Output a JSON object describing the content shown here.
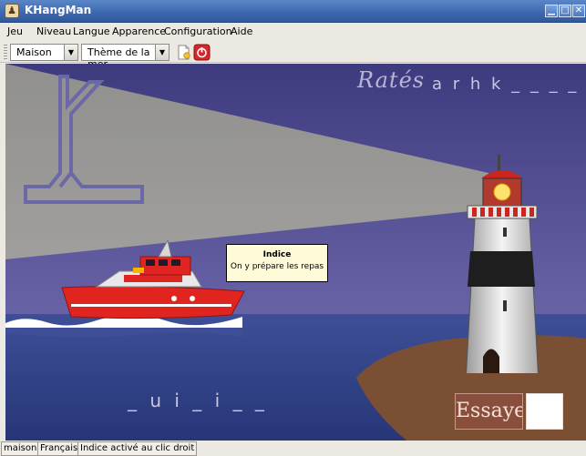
{
  "window": {
    "title": "KHangMan"
  },
  "menubar": {
    "items": [
      {
        "label": "Jeu"
      },
      {
        "label": "Niveau"
      },
      {
        "label": "Langue"
      },
      {
        "label": "Apparence"
      },
      {
        "label": "Configuration"
      },
      {
        "label": "Aide"
      }
    ]
  },
  "toolbar": {
    "category": "Maison",
    "theme": "Thème de la mer",
    "new_game_icon": "new-document-icon",
    "quit_icon": "power-icon"
  },
  "game": {
    "missed_label": "Ratés",
    "missed_letters": "a r h k _ _ _ _ _",
    "word_display": "_ u i _ i _ _",
    "try_button": "Essayer",
    "letter_input_value": ""
  },
  "hint": {
    "title": "Indice",
    "text": "On y prépare les repas"
  },
  "statusbar": {
    "category": "maison",
    "language": "Français",
    "hint_mode": "Indice activé au clic droit"
  },
  "colors": {
    "sky_top": "#3e3a7e",
    "sky_bottom": "#5f5a9e",
    "sea": "#2d3f86",
    "rock": "#7a4f33",
    "boat_red": "#e0241f",
    "light_beam": "#d6d79a",
    "gallows": "#6b68a8"
  }
}
